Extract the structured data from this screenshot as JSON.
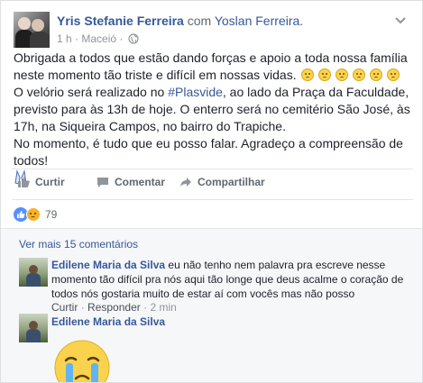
{
  "post": {
    "author": "Yris Stefanie Ferreira",
    "with_word": "com",
    "tagged": "Yoslan Ferreira.",
    "time": "1 h",
    "separator": "·",
    "location": "Maceió",
    "paragraph1": "Obrigada a todos que estão dando forças e apoio a toda nossa família neste momento tão triste e difícil em nossas vidas.",
    "paragraph2_before": "O velório será realizado no ",
    "hashtag": "#Plasvide",
    "paragraph2_after": ", ao lado da Praça da Faculdade, previsto para às 13h de hoje. O enterro será no cemitério São José, às 17h, na Siqueira Campos, no bairro do Trapiche.",
    "paragraph3": "No momento, é tudo que eu posso falar. Agradeço a compreensão de todos!",
    "emoji_icons": [
      "sad-face-emoji",
      "sad-face-emoji",
      "sad-face-emoji",
      "sad-face-emoji",
      "sad-face-emoji",
      "sad-face-emoji"
    ]
  },
  "actions": {
    "like": "Curtir",
    "comment": "Comentar",
    "share": "Compartilhar"
  },
  "reactions": {
    "count": "79",
    "types": [
      "like-reaction-icon",
      "sad-reaction-icon"
    ]
  },
  "comments": {
    "view_more": "Ver mais 15 comentários",
    "items": [
      {
        "name": "Edilene Maria da Silva",
        "text": "eu não tenho nem palavra pra escreve nesse momento tão difícil pra nós aqui tão longe que deus acalme o coração de todos nós gostaria muito de estar aí com vocês mas não posso",
        "like": "Curtir",
        "reply": "Responder",
        "dot": "·",
        "time": "2 min"
      },
      {
        "name": "Edilene Maria da Silva",
        "sticker": "crying-face-sticker"
      }
    ]
  },
  "colors": {
    "link": "#365899",
    "muted": "#90949c",
    "text": "#1d2129"
  }
}
